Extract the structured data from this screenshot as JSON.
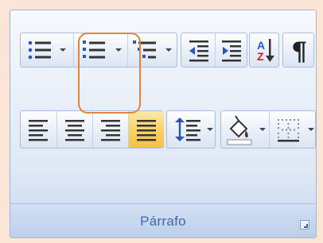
{
  "group": {
    "label": "Párrafo",
    "dialog_launcher_icon": "dialog-launcher-icon"
  },
  "row1": [
    {
      "name": "bullets",
      "icon": "bulleted-list-icon",
      "dropdown": true
    },
    {
      "name": "numbering",
      "icon": "numbered-list-icon",
      "dropdown": true,
      "highlighted": true
    },
    {
      "name": "multilevel-list",
      "icon": "multilevel-list-icon",
      "dropdown": true
    },
    {
      "name": "decrease-indent",
      "icon": "decrease-indent-icon"
    },
    {
      "name": "increase-indent",
      "icon": "increase-indent-icon"
    },
    {
      "name": "sort",
      "icon": "sort-az-icon"
    },
    {
      "name": "show-formatting",
      "icon": "pilcrow-icon"
    }
  ],
  "sort_glyphs": {
    "a": "A",
    "z": "Z"
  },
  "pilcrow": "¶",
  "row2": [
    {
      "name": "align-left",
      "icon": "align-left-icon"
    },
    {
      "name": "center",
      "icon": "align-center-icon"
    },
    {
      "name": "align-right",
      "icon": "align-right-icon"
    },
    {
      "name": "justify",
      "icon": "justify-icon",
      "active": true
    },
    {
      "name": "line-spacing",
      "icon": "line-spacing-icon",
      "dropdown": true
    },
    {
      "name": "shading",
      "icon": "paint-bucket-icon",
      "dropdown": true
    },
    {
      "name": "borders",
      "icon": "borders-icon",
      "dropdown": true
    }
  ],
  "colors": {
    "highlight_outline": "#e2843a",
    "active_fill": "#f8cf5e",
    "label_text": "#3e6aaa"
  }
}
